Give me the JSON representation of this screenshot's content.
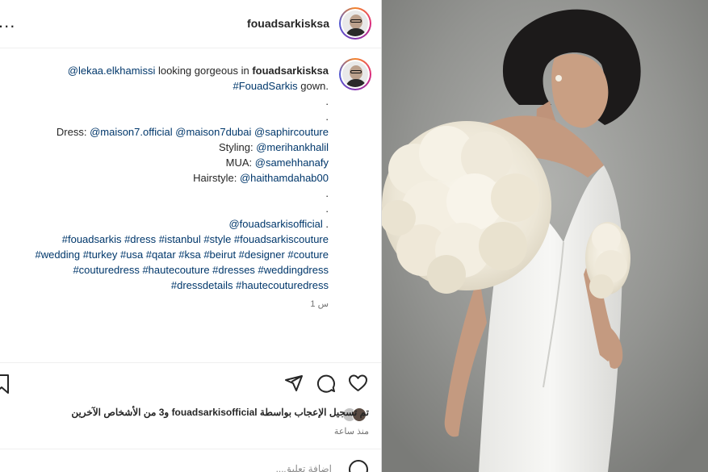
{
  "header": {
    "username": "fouadsarkisksa",
    "more_label": "..."
  },
  "caption": {
    "mention_main": "@lekaa.elkhamissi",
    "text_1": " looking gorgeous in ",
    "brand": "fouadsarkisksa",
    "hashtag_brand": "#FouadSarkis",
    "text_2": " gown.",
    "dot": ".",
    "dress_label": "Dress: ",
    "dress_mentions": [
      "@maison7.official",
      "@maison7dubai",
      "@saphircouture"
    ],
    "styling_label": "Styling: ",
    "styling_mention": "@merihankhalil",
    "mua_label": "MUA: ",
    "mua_mention": "@samehhanafy",
    "hair_label": "Hairstyle: ",
    "hair_mention": "@haithamdahab00",
    "official_mention": "@fouadsarkisofficial",
    "hashtag_lines": [
      "#fouadsarkis #dress #istanbul #style #fouadsarkiscouture",
      "#wedding #turkey #usa #qatar #ksa #beirut #designer #couture",
      "#couturedress #hautecouture #dresses #weddingdress",
      "#dressdetails #hautecouturedress"
    ],
    "time": "1 س"
  },
  "footer": {
    "likes_text": "تم تسجيل الإعجاب بواسطة fouadsarkisofficial و3 من الأشخاص الآخرين",
    "time_ago": "منذ ساعة",
    "comment_placeholder": "إضافة تعليق..."
  },
  "icons": {
    "like": "heart-icon",
    "comment": "comment-icon",
    "share": "share-icon",
    "save": "bookmark-icon",
    "emoji": "emoji-icon"
  },
  "colors": {
    "link": "#00376b",
    "text": "#262626",
    "muted": "#737373",
    "border": "#efefef",
    "photo_bg": "#9a9b98"
  }
}
